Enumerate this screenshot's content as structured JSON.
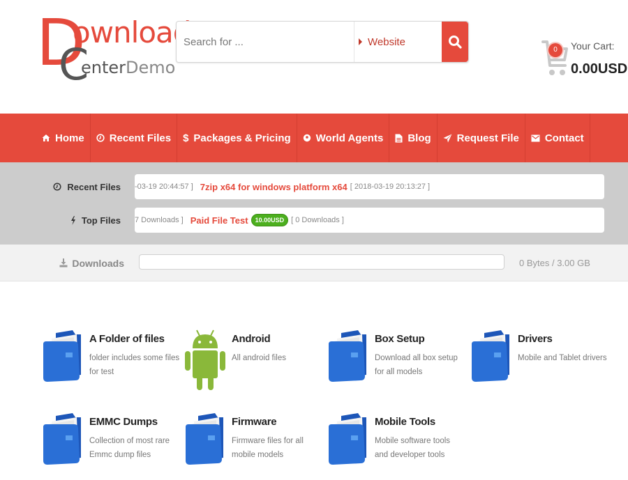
{
  "brand": {
    "logo_d": "D",
    "logo_ownload": "ownload",
    "logo_c": "C",
    "logo_enter": "enter",
    "logo_demo": "Demo",
    "primary_color": "#e54a3c"
  },
  "search": {
    "placeholder": "Search for ...",
    "value": "",
    "scope_label": "Website",
    "submit_icon": "search-icon"
  },
  "cart": {
    "label": "Your Cart:",
    "count": "0",
    "total": "0.00USD",
    "icon": "cart-icon"
  },
  "nav": {
    "items": [
      {
        "label": "Home",
        "icon": "home-icon"
      },
      {
        "label": "Recent Files",
        "icon": "clock-icon"
      },
      {
        "label": "Packages & Pricing",
        "icon": "dollar-icon"
      },
      {
        "label": "World Agents",
        "icon": "map-pin-icon"
      },
      {
        "label": "Blog",
        "icon": "document-icon"
      },
      {
        "label": "Request File",
        "icon": "paper-plane-icon"
      },
      {
        "label": "Contact",
        "icon": "envelope-icon"
      }
    ]
  },
  "ticker": {
    "recent": {
      "label": "Recent Files",
      "prefix_meta": "-03-19 20:44:57 ]",
      "title": "7zip x64 for windows platform x64",
      "suffix_meta": "[ 2018-03-19 20:13:27 ]"
    },
    "top": {
      "label": "Top Files",
      "prefix_meta": "7 Downloads ]",
      "title": "Paid File Test",
      "price": "10.00USD",
      "suffix_meta": "[ 0 Downloads ]"
    }
  },
  "downloads": {
    "label": "Downloads",
    "used_fraction": 0,
    "usage_text": "0 Bytes / 3.00 GB"
  },
  "categories": [
    {
      "title": "A Folder of files",
      "desc": "folder includes some files for test",
      "icon": "folder-icon"
    },
    {
      "title": "Android",
      "desc": "All android files",
      "icon": "android-icon"
    },
    {
      "title": "Box Setup",
      "desc": "Download all box setup for all models",
      "icon": "folder-icon"
    },
    {
      "title": "Drivers",
      "desc": "Mobile and Tablet drivers",
      "icon": "folder-icon"
    },
    {
      "title": "EMMC Dumps",
      "desc": "Collection of most rare Emmc dump files",
      "icon": "folder-icon"
    },
    {
      "title": "Firmware",
      "desc": "Firmware files for all mobile models",
      "icon": "folder-icon"
    },
    {
      "title": "Mobile Tools",
      "desc": "Mobile software tools and developer tools",
      "icon": "folder-icon"
    }
  ]
}
